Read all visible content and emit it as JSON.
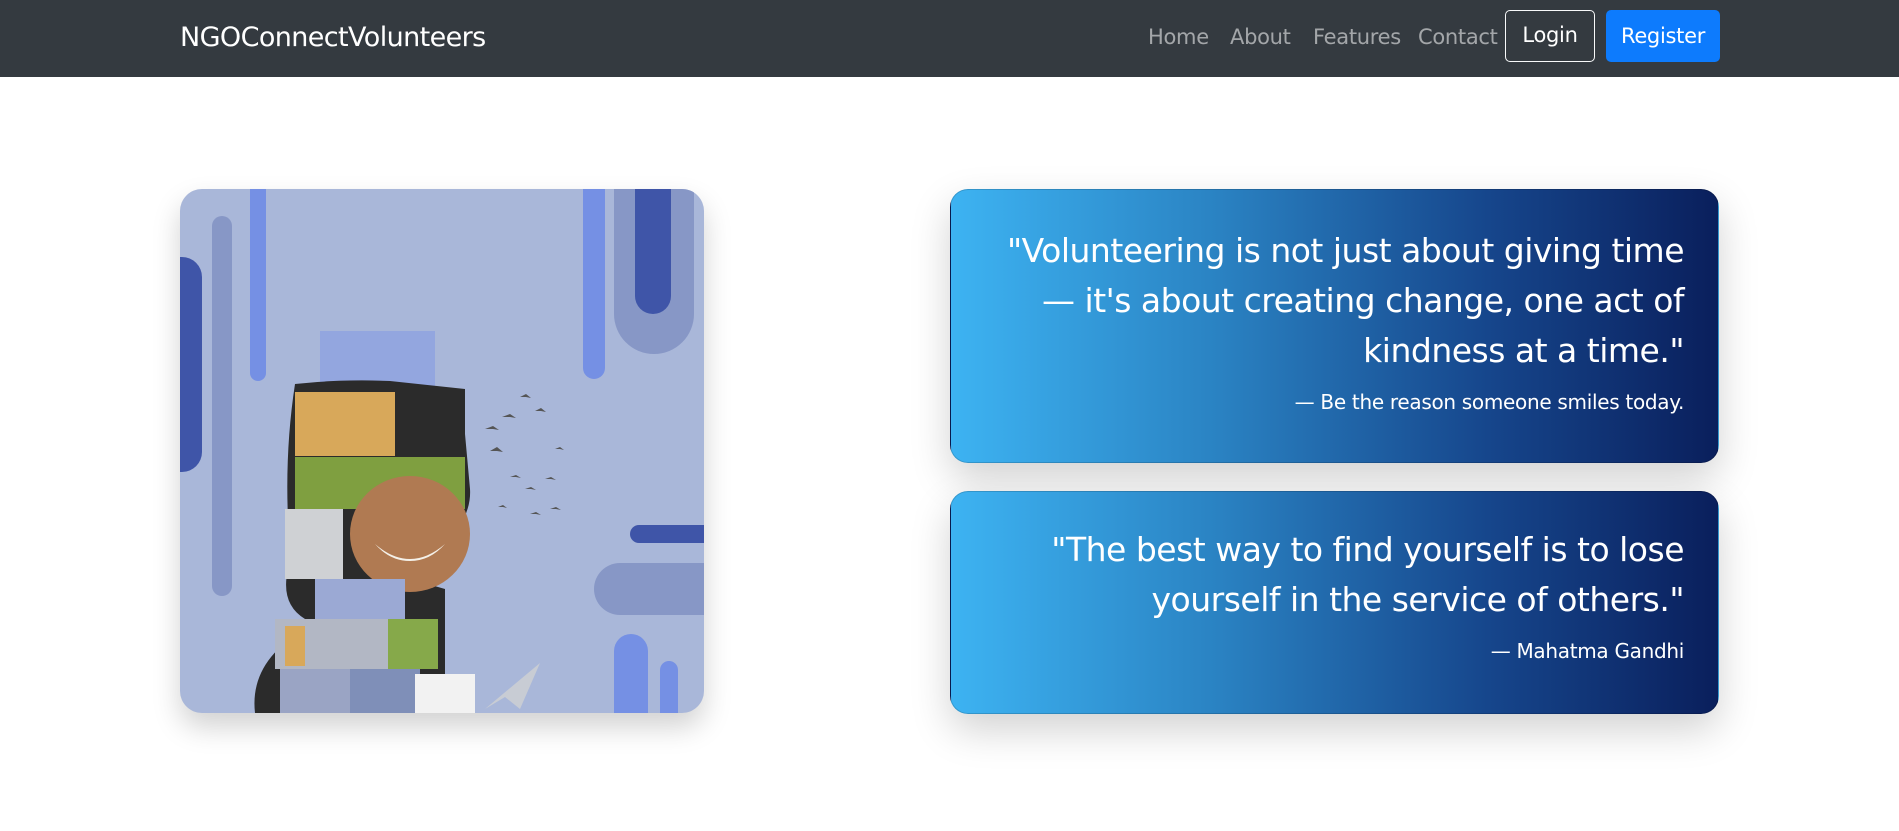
{
  "navbar": {
    "brand": "NGOConnectVolunteers",
    "links": [
      "Home",
      "About",
      "Features",
      "Contact"
    ],
    "login_label": "Login",
    "register_label": "Register"
  },
  "hero": {
    "image_description_icon": "volunteer-collage-image",
    "quotes": [
      {
        "text": "\"Volunteering is not just about giving time — it's about creating change, one act of kindness at a time.\"",
        "author": "— Be the reason someone smiles today."
      },
      {
        "text": "\"The best way to find yourself is to lose yourself in the service of others.\"",
        "author": "— Mahatma Gandhi"
      }
    ]
  },
  "colors": {
    "navbar_bg": "#343a40",
    "register_button": "#0d7bfd",
    "quote_gradient_start": "#3db3f2",
    "quote_gradient_end": "#0a1f5c",
    "image_bg": "#a9b7d9"
  }
}
